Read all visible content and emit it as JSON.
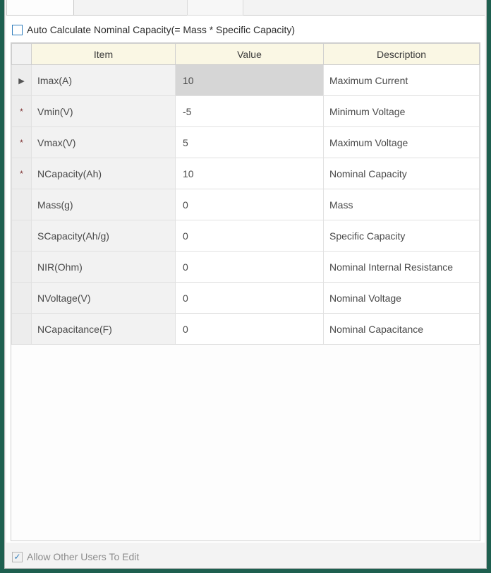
{
  "auto_calc": {
    "label": "Auto Calculate Nominal Capacity(= Mass * Specific Capacity)",
    "checked": false
  },
  "columns": {
    "item": "Item",
    "value": "Value",
    "desc": "Description"
  },
  "rows": [
    {
      "marker": "▶",
      "item": "Imax(A)",
      "value": "10",
      "desc": "Maximum Current",
      "selected": true
    },
    {
      "marker": "*",
      "item": "Vmin(V)",
      "value": "-5",
      "desc": "Minimum Voltage",
      "selected": false
    },
    {
      "marker": "*",
      "item": "Vmax(V)",
      "value": "5",
      "desc": "Maximum Voltage",
      "selected": false
    },
    {
      "marker": "*",
      "item": "NCapacity(Ah)",
      "value": "10",
      "desc": "Nominal Capacity",
      "selected": false
    },
    {
      "marker": "",
      "item": "Mass(g)",
      "value": "0",
      "desc": "Mass",
      "selected": false
    },
    {
      "marker": "",
      "item": "SCapacity(Ah/g)",
      "value": "0",
      "desc": "Specific Capacity",
      "selected": false
    },
    {
      "marker": "",
      "item": "NIR(Ohm)",
      "value": "0",
      "desc": "Nominal Internal Resistance",
      "selected": false
    },
    {
      "marker": "",
      "item": "NVoltage(V)",
      "value": "0",
      "desc": "Nominal Voltage",
      "selected": false
    },
    {
      "marker": "",
      "item": "NCapacitance(F)",
      "value": "0",
      "desc": "Nominal Capacitance",
      "selected": false
    }
  ],
  "footer": {
    "label": "Allow Other Users To Edit",
    "checked": true,
    "disabled": true
  }
}
